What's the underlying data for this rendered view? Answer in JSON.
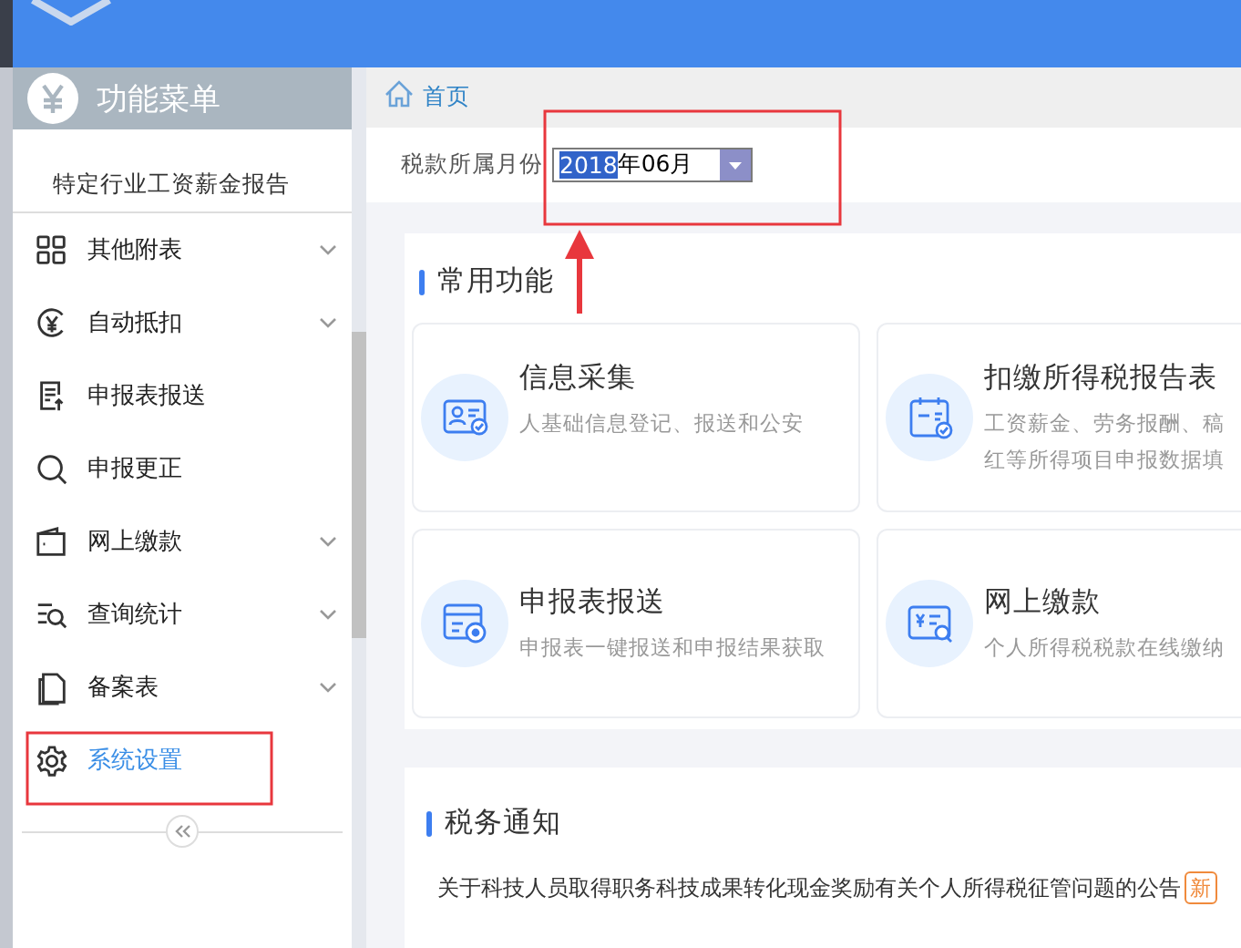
{
  "sidebar": {
    "title": "功能菜单",
    "subitem": "特定行业工资薪金报告",
    "items": [
      {
        "label": "其他附表",
        "kind": "grid",
        "expandable": true,
        "selected": false
      },
      {
        "label": "自动抵扣",
        "kind": "yen",
        "expandable": true,
        "selected": false
      },
      {
        "label": "申报表报送",
        "kind": "upload",
        "expandable": false,
        "selected": false
      },
      {
        "label": "申报更正",
        "kind": "search",
        "expandable": false,
        "selected": false
      },
      {
        "label": "网上缴款",
        "kind": "wallet",
        "expandable": true,
        "selected": false
      },
      {
        "label": "查询统计",
        "kind": "list",
        "expandable": true,
        "selected": false
      },
      {
        "label": "备案表",
        "kind": "doc",
        "expandable": true,
        "selected": false
      },
      {
        "label": "系统设置",
        "kind": "gear",
        "expandable": false,
        "selected": true
      }
    ]
  },
  "breadcrumb": "首页",
  "tax_period": {
    "label": "税款所属月份",
    "selected_text": "2018",
    "text": "年06月"
  },
  "common_functions": {
    "title": "常用功能",
    "cards": [
      {
        "kind": "person",
        "title": "信息采集",
        "description": [
          "人基础信息登记、报送和公安"
        ]
      },
      {
        "kind": "tax",
        "title": "扣缴所得税报告表",
        "description": [
          "工资薪金、劳务报酬、稿",
          "红等所得项目申报数据填"
        ]
      },
      {
        "kind": "send",
        "title": "申报表报送",
        "description": [
          "申报表一键报送和申报结果获取"
        ]
      },
      {
        "kind": "pay",
        "title": "网上缴款",
        "description": [
          "个人所得税税款在线缴纳"
        ]
      }
    ]
  },
  "notices": {
    "title": "税务通知",
    "items": [
      {
        "text": "关于科技人员取得职务科技成果转化现金奖励有关个人所得税征管问题的公告",
        "new": true,
        "badge": "新"
      }
    ]
  }
}
